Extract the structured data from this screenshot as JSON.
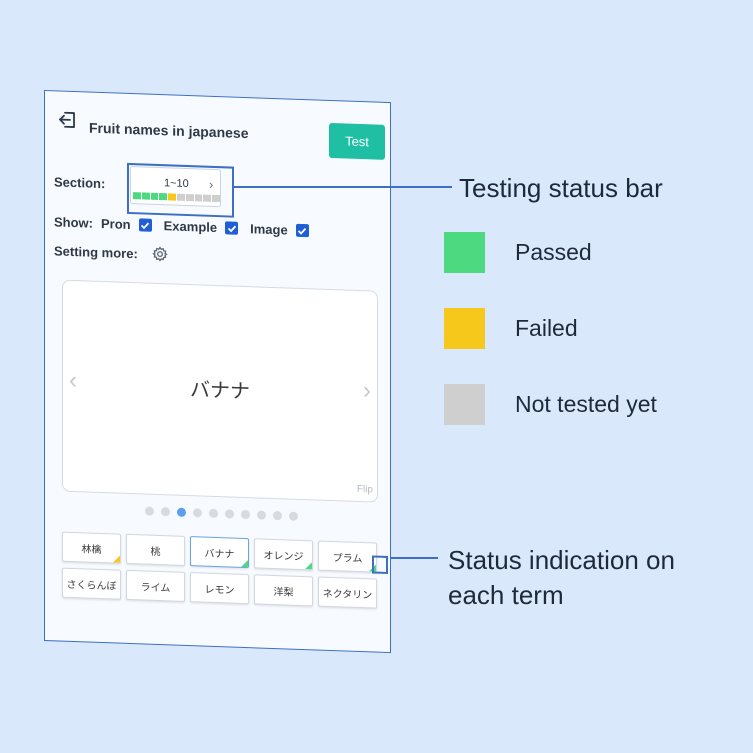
{
  "app": {
    "title": "Fruit names in japanese",
    "test_label": "Test"
  },
  "section": {
    "label": "Section:",
    "range": "1~10",
    "segments": [
      "passed",
      "passed",
      "passed",
      "passed",
      "failed",
      "not_tested",
      "not_tested",
      "not_tested",
      "not_tested",
      "not_tested"
    ]
  },
  "show": {
    "label": "Show:",
    "options": [
      {
        "label": "Pron",
        "checked": true
      },
      {
        "label": "Example",
        "checked": true
      },
      {
        "label": "Image",
        "checked": true
      }
    ]
  },
  "setting": {
    "label": "Setting more:",
    "icon": "gear-icon"
  },
  "flashcard": {
    "word": "バナナ",
    "flip_label": "Flip",
    "prev_icon": "chevron-left-icon",
    "next_icon": "chevron-right-icon"
  },
  "pagination": {
    "total": 10,
    "current": 3
  },
  "terms": [
    {
      "text": "林檎",
      "status": "failed"
    },
    {
      "text": "桃",
      "status": "not_tested"
    },
    {
      "text": "バナナ",
      "status": "passed",
      "selected": true
    },
    {
      "text": "オレンジ",
      "status": "passed"
    },
    {
      "text": "プラム",
      "status": "passed"
    },
    {
      "text": "さくらんぼ",
      "status": "not_tested"
    },
    {
      "text": "ライム",
      "status": "not_tested"
    },
    {
      "text": "レモン",
      "status": "not_tested"
    },
    {
      "text": "洋梨",
      "status": "not_tested"
    },
    {
      "text": "ネクタリン",
      "status": "not_tested"
    }
  ],
  "annotations": {
    "status_bar": "Testing status bar",
    "term_status": "Status indication on each term"
  },
  "legend": [
    {
      "label": "Passed",
      "color": "#4cd980"
    },
    {
      "label": "Failed",
      "color": "#f6c81c"
    },
    {
      "label": "Not tested yet",
      "color": "#cfcfcf"
    }
  ],
  "colors": {
    "accent": "#1fbfa3",
    "frame": "#3d6fc4",
    "passed": "#4cd980",
    "failed": "#f6c81c",
    "not_tested": "#cfcfcf"
  }
}
